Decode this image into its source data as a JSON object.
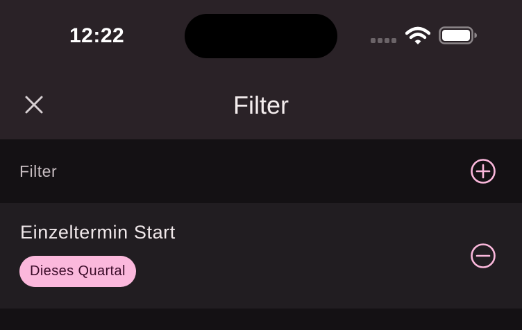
{
  "status_bar": {
    "time": "12:22"
  },
  "header": {
    "title": "Filter",
    "close_icon": "close-icon"
  },
  "filter_section": {
    "label": "Filter",
    "add_icon": "plus-circle-icon"
  },
  "filters": [
    {
      "title": "Einzeltermin Start",
      "chip_label": "Dieses Quartal",
      "remove_icon": "minus-circle-icon"
    }
  ],
  "colors": {
    "accent": "#fbb8dc",
    "chip_text": "#3a0b28",
    "top_bar_bg": "#2a2227",
    "section_bg": "#141114",
    "item_bg": "#211d21"
  }
}
